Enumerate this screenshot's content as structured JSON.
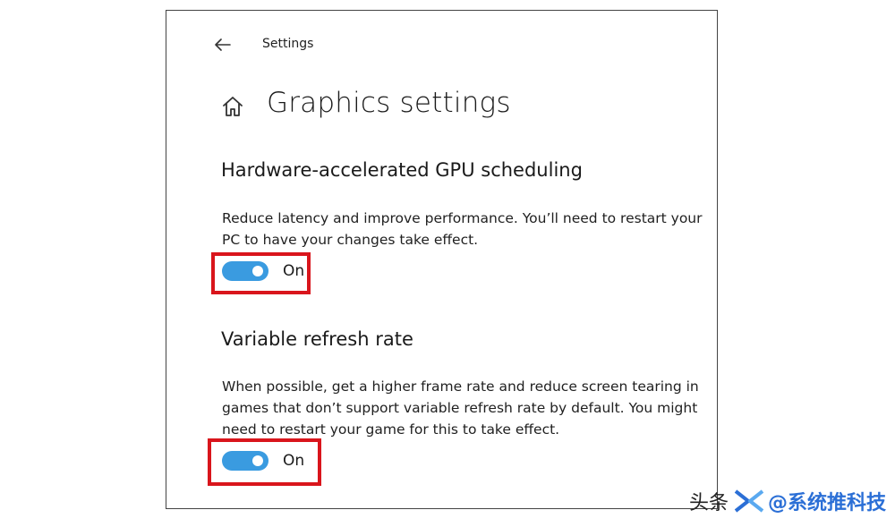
{
  "header": {
    "back_icon": "back-arrow-icon",
    "title": "Settings"
  },
  "page": {
    "home_icon": "home-icon",
    "title": "Graphics settings"
  },
  "sections": [
    {
      "heading": "Hardware-accelerated GPU scheduling",
      "description": "Reduce latency and improve performance. You’ll need to restart your PC to have your changes take effect.",
      "toggle_state": "On",
      "toggle_on": true
    },
    {
      "heading": "Variable refresh rate",
      "description": "When possible, get a higher frame rate and reduce screen tearing in games that don’t support variable refresh rate by default. You might need to restart your game for this to take effect.",
      "toggle_state": "On",
      "toggle_on": true
    }
  ],
  "colors": {
    "toggle_on": "#3a9be0",
    "highlight": "#d9151c",
    "window_border": "#444444"
  },
  "watermark": {
    "prefix": "头条",
    "brand": "@系统推科技"
  }
}
